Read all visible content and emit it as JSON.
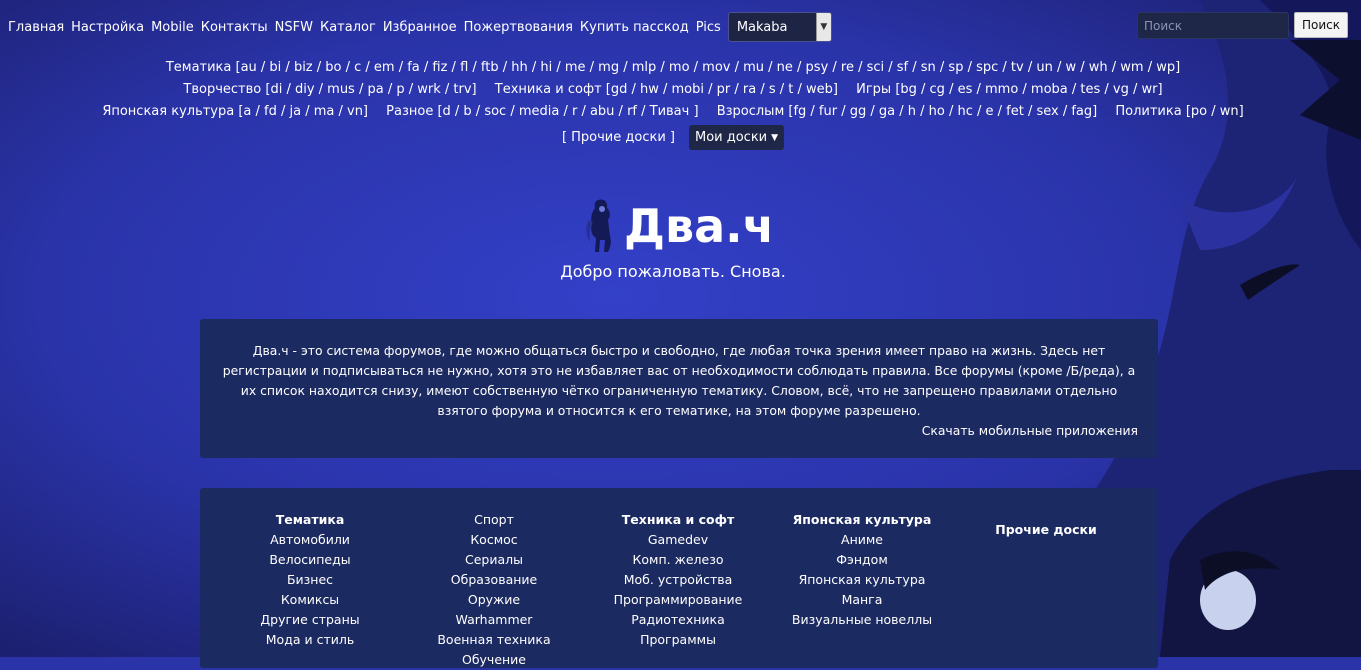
{
  "topnav": {
    "links": [
      "Главная",
      "Настройка",
      "Mobile",
      "Контакты",
      "NSFW",
      "Каталог",
      "Избранное",
      "Пожертвования",
      "Купить пасскод",
      "Pics"
    ],
    "style_select": "Makaba"
  },
  "search": {
    "placeholder": "Поиск",
    "button": "Поиск"
  },
  "boards": {
    "rows": [
      [
        "Тематика [au / bi / biz / bo / c / em / fa / fiz / fl / ftb / hh / hi / me / mg / mlp / mo / mov / mu / ne / psy / re / sci / sf / sn / sp / spc / tv / un / w / wh / wm / wp]"
      ],
      [
        "Творчество [di / diy / mus / pa / p / wrk / trv]",
        "Техника и софт [gd / hw / mobi / pr / ra / s / t / web]",
        "Игры [bg / cg / es / mmo / moba / tes / vg / wr]"
      ],
      [
        "Японская культура [a / fd / ja / ma / vn]",
        "Разное [d / b / soc / media / r / abu / rf / Тивач ]",
        "Взрослым [fg / fur / gg / ga / h / ho / hc / e / fet / sex / fag]",
        "Политика [po / wn]"
      ]
    ],
    "other": "[ Прочие доски ]",
    "my_boards": "Мои доски"
  },
  "logo": {
    "title": "Два.ч"
  },
  "welcome": "Добро пожаловать. Снова.",
  "intro": {
    "text": "Два.ч - это система форумов, где можно общаться быстро и свободно, где любая точка зрения имеет право на жизнь. Здесь нет регистрации и подписываться не нужно, хотя это не избавляет вас от необходимости соблюдать правила. Все форумы (кроме /Б/реда), а их список находится снизу, имеют собственную чётко ограниченную тематику. Словом, всё, что не запрещено правилами отдельно взятого форума и относится к его тематике, на этом форуме разрешено.",
    "download": "Скачать мобильные приложения"
  },
  "categories": [
    {
      "title": "Тематика",
      "items": [
        "Автомобили",
        "Велосипеды",
        "Бизнес",
        "Комиксы",
        "Другие страны",
        "Мода и стиль"
      ]
    },
    {
      "title": "",
      "items": [
        "Спорт",
        "Космос",
        "Сериалы",
        "Образование",
        "Оружие",
        "Warhammer",
        "Военная техника",
        "Обучение"
      ]
    },
    {
      "title": "Техника и софт",
      "items": [
        "Gamedev",
        "Комп. железо",
        "Моб. устройства",
        "Программирование",
        "Радиотехника",
        "Программы"
      ]
    },
    {
      "title": "Японская культура",
      "items": [
        "Аниме",
        "Фэндом",
        "Японская культура",
        "Манга",
        "Визуальные новеллы"
      ]
    },
    {
      "title": "Прочие доски",
      "items": []
    }
  ],
  "colors": {
    "background": "#2a34a8",
    "panel": "#1c2a62",
    "accent": "#1e2748"
  }
}
